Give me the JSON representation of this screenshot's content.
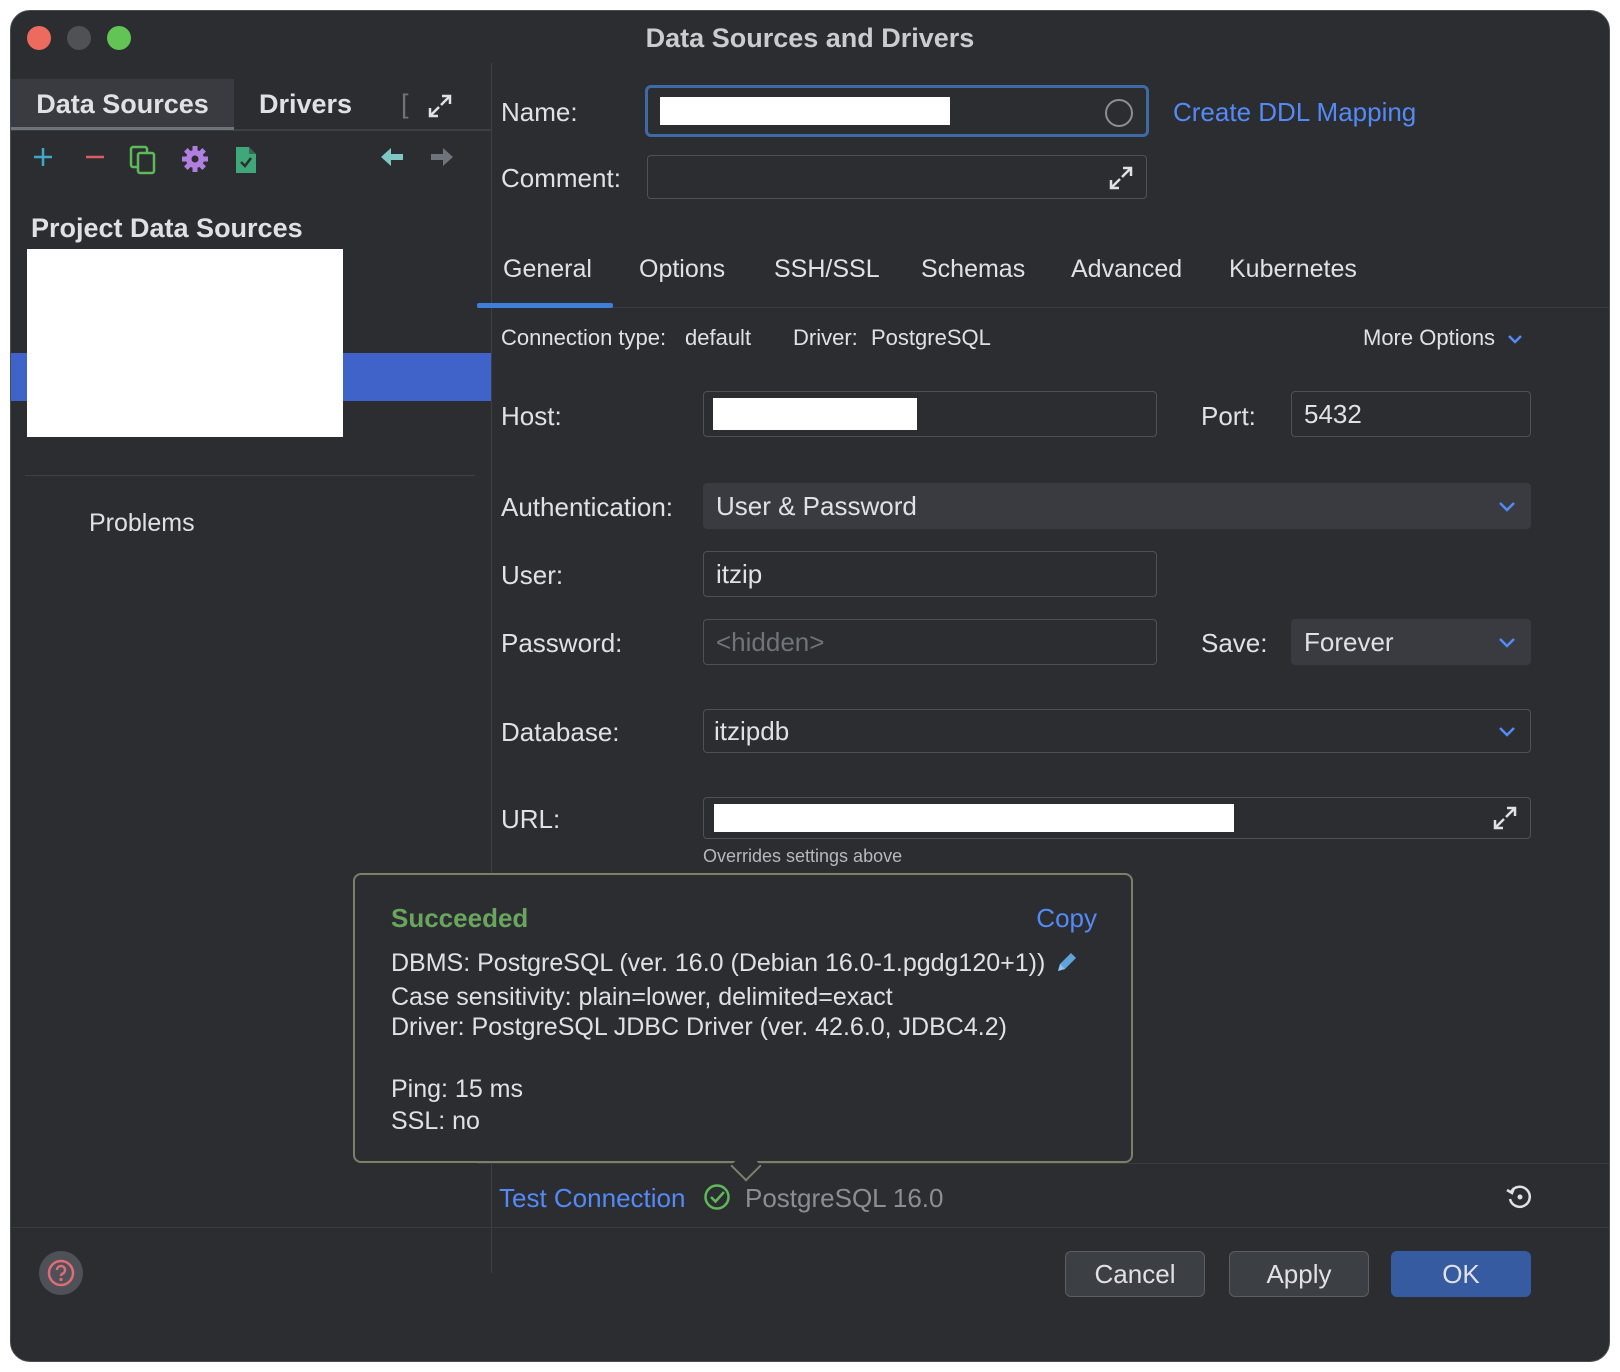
{
  "window": {
    "title": "Data Sources and Drivers"
  },
  "left": {
    "tabs": [
      "Data Sources",
      "Drivers",
      "["
    ],
    "section_title": "Project Data Sources",
    "problems_label": "Problems"
  },
  "header": {
    "name_label": "Name:",
    "comment_label": "Comment:",
    "create_ddl_label": "Create DDL Mapping"
  },
  "tabs": [
    "General",
    "Options",
    "SSH/SSL",
    "Schemas",
    "Advanced",
    "Kubernetes"
  ],
  "general": {
    "connection_type_label": "Connection type:",
    "connection_type_value": "default",
    "driver_label": "Driver:",
    "driver_value": "PostgreSQL",
    "more_options_label": "More Options",
    "host_label": "Host:",
    "port_label": "Port:",
    "port_value": "5432",
    "auth_label": "Authentication:",
    "auth_value": "User & Password",
    "user_label": "User:",
    "user_value": "itzip",
    "password_label": "Password:",
    "password_placeholder": "<hidden>",
    "save_label": "Save:",
    "save_value": "Forever",
    "database_label": "Database:",
    "database_value": "itzipdb",
    "url_label": "URL:",
    "url_hint": "Overrides settings above"
  },
  "popup": {
    "status": "Succeeded",
    "copy_label": "Copy",
    "dbms": "DBMS: PostgreSQL (ver. 16.0 (Debian 16.0-1.pgdg120+1))",
    "case_sensitivity": "Case sensitivity: plain=lower, delimited=exact",
    "driver": "Driver: PostgreSQL JDBC Driver (ver. 42.6.0, JDBC4.2)",
    "ping": "Ping: 15 ms",
    "ssl": "SSL: no"
  },
  "status_bar": {
    "test_connection_label": "Test Connection",
    "server_version": "PostgreSQL 16.0"
  },
  "buttons": {
    "cancel": "Cancel",
    "apply": "Apply",
    "ok": "OK"
  },
  "colors": {
    "background": "#2b2d30",
    "accent_link": "#548af7",
    "selection": "#3f63c9",
    "success": "#6aa55e",
    "close": "#ed6a5e",
    "maximize": "#61c454"
  }
}
